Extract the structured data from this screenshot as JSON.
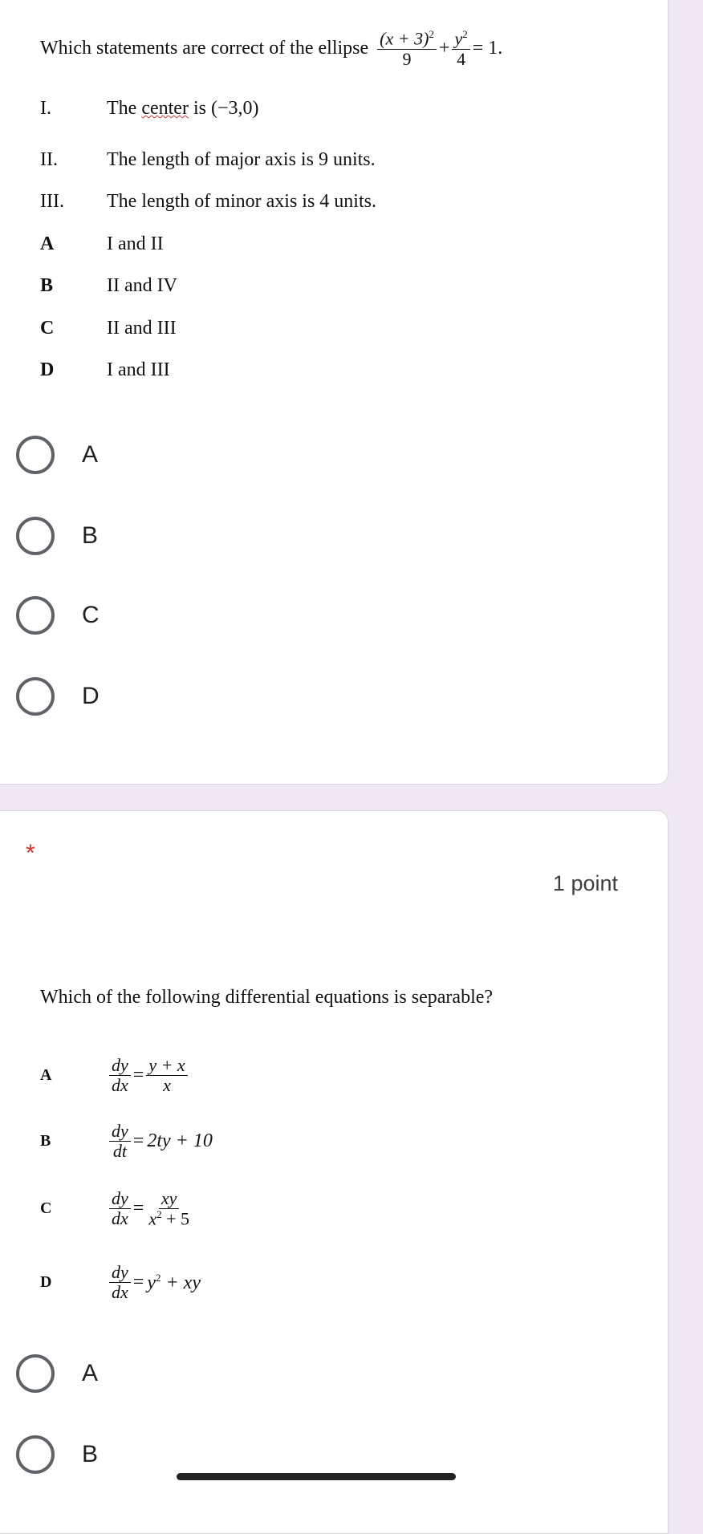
{
  "q1": {
    "prompt": "Which statements are correct of the ellipse",
    "equation": {
      "num1": "(x + 3)",
      "num1_exp": "2",
      "den1": "9",
      "plus": "+",
      "num2": "y",
      "num2_exp": "2",
      "den2": "4",
      "rhs": "= 1."
    },
    "statements": [
      {
        "numeral": "I.",
        "text_before": "The ",
        "text_flagged": "center",
        "text_after": " is (−3,0)"
      },
      {
        "numeral": "II.",
        "text": "The length of major axis is 9 units."
      },
      {
        "numeral": "III.",
        "text": "The length of minor axis is 4 units."
      }
    ],
    "choices": [
      {
        "letter": "A",
        "text": "I and II"
      },
      {
        "letter": "B",
        "text": "II and IV"
      },
      {
        "letter": "C",
        "text": "II and III"
      },
      {
        "letter": "D",
        "text": "I and III"
      }
    ],
    "radio_options": [
      "A",
      "B",
      "C",
      "D"
    ]
  },
  "q2": {
    "required_mark": "*",
    "points": "1 point",
    "prompt": "Which of the following differential equations is separable?",
    "choices": [
      {
        "letter": "A",
        "lhs_num": "dy",
        "lhs_den": "dx",
        "eq": "=",
        "rhs_num": "y + x",
        "rhs_den": "x"
      },
      {
        "letter": "B",
        "lhs_num": "dy",
        "lhs_den": "dt",
        "eq": "=",
        "rhs": "2ty + 10"
      },
      {
        "letter": "C",
        "lhs_num": "dy",
        "lhs_den": "dx",
        "eq": "=",
        "rhs_num": "xy",
        "rhs_den_base": "x",
        "rhs_den_exp": "2",
        "rhs_den_rest": " + 5"
      },
      {
        "letter": "D",
        "lhs_num": "dy",
        "lhs_den": "dx",
        "eq": "=",
        "rhs_base": "y",
        "rhs_exp": "2",
        "rhs_rest": " + xy"
      }
    ],
    "radio_options": [
      "A",
      "B"
    ]
  },
  "colors": {
    "background": "#efe8f2",
    "required": "#d93025",
    "radio_border": "#5f6368"
  }
}
